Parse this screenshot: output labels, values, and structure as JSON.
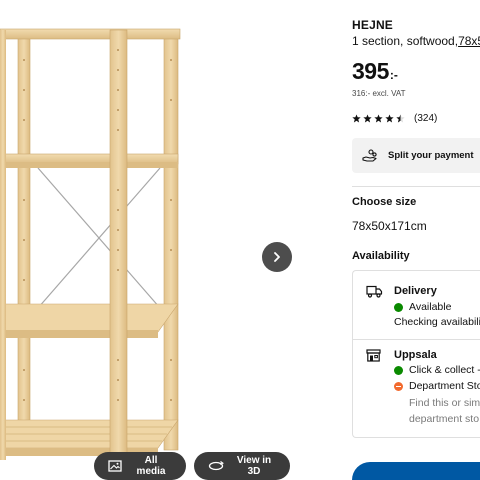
{
  "gallery": {
    "next_icon": "chevron-right-icon",
    "all_media_label": "All media",
    "all_media_icon": "image-icon",
    "view_3d_label": "View in 3D",
    "view_3d_icon": "rotate-3d-icon",
    "wood_color": "#ecd2a0"
  },
  "product": {
    "name": "HEJNE",
    "description": "1 section, softwood,",
    "dimensions_link": "78x5",
    "price_main": "395",
    "price_suffix": ":-",
    "price_excl_vat": "316:- excl. VAT",
    "rating_value": 4.5,
    "rating_max": 5,
    "rating_count": "(324)",
    "split_payment_label": "Split your payment",
    "split_payment_icon": "hand-coins-icon"
  },
  "size": {
    "heading": "Choose size",
    "value": "78x50x171cm"
  },
  "availability": {
    "heading": "Availability",
    "delivery": {
      "icon": "truck-icon",
      "title": "Delivery",
      "status": "Available",
      "status_color": "#0a8a00",
      "note": "Checking availabili"
    },
    "store": {
      "icon": "store-icon",
      "title": "Uppsala",
      "click_collect": "Click & collect -",
      "click_collect_color": "#0a8a00",
      "department": "Department Sto",
      "department_color": "#f26a2e",
      "find_line1": "Find this or simi",
      "find_line2": "department sto"
    }
  },
  "cart": {
    "color": "#0058a3"
  }
}
